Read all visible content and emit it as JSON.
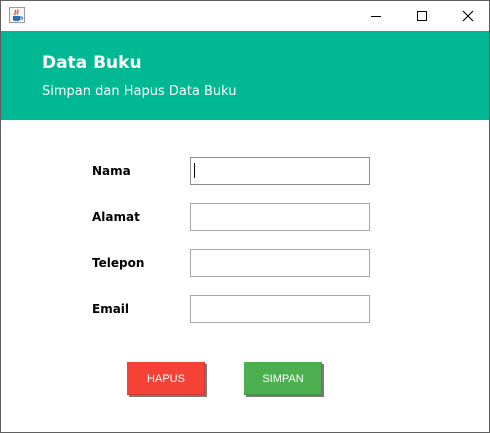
{
  "window": {
    "app_icon": "java-cup-icon",
    "controls": [
      "minimize-icon",
      "maximize-icon",
      "close-icon"
    ]
  },
  "header": {
    "title": "Data Buku",
    "subtitle": "Simpan dan Hapus Data Buku",
    "background_color": "#00b894"
  },
  "form": {
    "fields": [
      {
        "label": "Nama",
        "value": "",
        "focused": true
      },
      {
        "label": "Alamat",
        "value": ""
      },
      {
        "label": "Telepon",
        "value": ""
      },
      {
        "label": "Email",
        "value": ""
      }
    ]
  },
  "buttons": {
    "hapus_label": "HAPUS",
    "hapus_color": "#f44336",
    "simpan_label": "SIMPAN",
    "simpan_color": "#4caf50"
  }
}
